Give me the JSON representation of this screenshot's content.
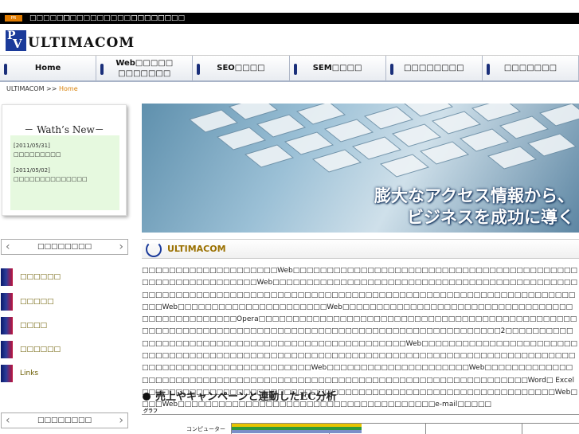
{
  "topbar": {
    "badge": "PR",
    "links": [
      "□□□□□□",
      "□□□□□□□□□□□□□□□□",
      "□□□□□□□□"
    ]
  },
  "logo": {
    "mark_p": "P",
    "mark_v": "V",
    "text": "ULTIMACOM"
  },
  "nav": {
    "items": [
      {
        "label": "Home"
      },
      {
        "label": "Web□□□□□□□□□□□□"
      },
      {
        "label": "SEO□□□□"
      },
      {
        "label": "SEM□□□□"
      },
      {
        "label": "□□□□□□□□"
      },
      {
        "label": "□□□□□□□"
      }
    ]
  },
  "breadcrumb": {
    "root": "ULTIMACOM",
    "sep": ">>",
    "current": "Home"
  },
  "news": {
    "title": "－ Wath’s New－",
    "items": [
      {
        "date": "[2011/05/31]",
        "text": "□□□□□□□□□"
      },
      {
        "date": "[2011/05/02]",
        "text": "□□□□□□□□□□□□□□"
      }
    ]
  },
  "sidebar": {
    "header1": "□□□□□□□□",
    "items": [
      {
        "label": "□□□□□□"
      },
      {
        "label": "□□□□□"
      },
      {
        "label": "□□□□"
      },
      {
        "label": "□□□□□□"
      },
      {
        "label": "Links"
      }
    ],
    "header2": "□□□□□□□□"
  },
  "hero": {
    "line1": "膨大なアクセス情報から、",
    "line2": "ビジネスを成功に導く"
  },
  "section": {
    "title": "ULTIMACOM",
    "body": "□□□□□□□□□□□□□□□□□□□□Web□□□□□□□□□□□□□□□□□□□□□□□□□□□□□□□□□□□□□□□□□□□□□□□□□□□□□□□□□□□Web□□□□□□□□□□□□□□□□□□□□□□□□□□□□□□□□□□□□□□□□□□□□□□□□□□□□□□□□□□□□□□□□□□□□□□□□□□□□□□□□□□□□□□□□□□□□□□□□□□□□□□□□□□□□□□□□Web□□□□□□□□□□□□□□□□□□□□□□Web□□□□□□□□□□□□□□□□□□□□□□□□□□□□□□□□□□□□□□□□□□□□□□□□Opera□□□□□□□□□□□□□□□□□□□□□□□□□□□□□□□□□□□□□□□□□□□□□□□□□□□□□□□□□□□□□□□□□□□□□□□□□□□□□□□□□□□□□□□□□□□□□□□□□□□□2□□□□□□□□□□□□□□□□□□□□□□□□□□□□□□□□□□□□□□□□□□□□□□□□□Web□□□□□□□□□□□□□□□□□□□□□□□□□□□□□□□□□□□□□□□□□□□□□□□□□□□□□□□□□□□□□□□□□□□□□□□□□□□□□□□□□□□□□□□□□□□□□□□□□□□□□□□□□□□□□□□□Web□□□□□□□□□□□□□□□□□□□□□Web□□□□□□□□□□□□□□□□□□□□□□□□□□□□□□□□□□□□□□□□□□□□□□□□□□□□□□□□□□□□□□□□□□□□□□Word□ Excel□□□□□□□□□□□□□□□□□□□□□□□□□□□□□□□□□□□□□□□□□□□□□□□□□□□□□□□□□□□□□Web□□□□Web□□□□□□□□□□□□□□□□□□□□□□□□□□□□□□□□□□□□□□e-mail□□□□□"
  },
  "subsection": {
    "title": "売上やキャンペーンと連動したEC分析"
  },
  "graph": {
    "label": "グラフ",
    "category": "コンピューター",
    "bar_colors": [
      "#e8c400",
      "#2f9a3a",
      "#7a8fc8"
    ]
  }
}
